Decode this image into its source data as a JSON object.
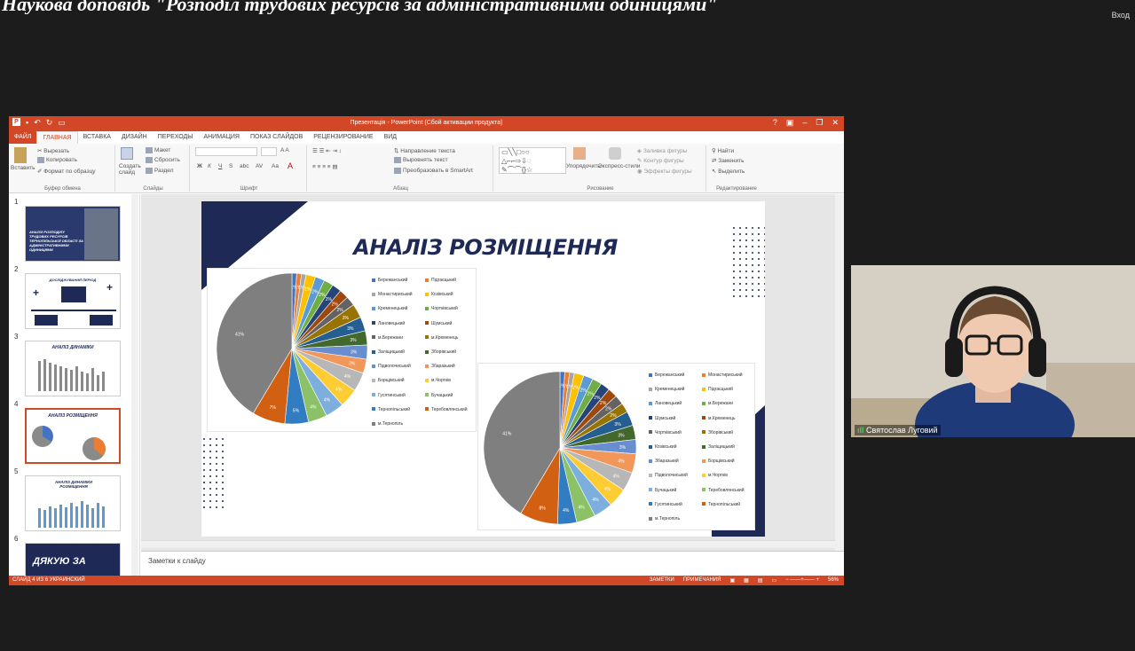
{
  "meeting": {
    "title": "Наукова доповідь \"Розподіл трудових ресурсів за адміністративними одиницями\"",
    "exit_label": "Вход"
  },
  "ppt": {
    "window_title": "Презентація - PowerPoint (Сбой активации продукта)",
    "tabs": [
      "ФАЙЛ",
      "ГЛАВНАЯ",
      "ВСТАВКА",
      "ДИЗАЙН",
      "ПЕРЕХОДЫ",
      "АНИМАЦИЯ",
      "ПОКАЗ СЛАЙДОВ",
      "РЕЦЕНЗИРОВАНИЕ",
      "ВИД"
    ],
    "ribbon": {
      "paste": "Вставить",
      "cut": "Вырезать",
      "copy": "Копировать",
      "format_painter": "Формат по образцу",
      "clipboard_group": "Буфер обмена",
      "create_slide": "Создать слайд",
      "layout": "Макет",
      "reset": "Сбросить",
      "section": "Раздел",
      "slides_group": "Слайды",
      "font_group": "Шрифт",
      "text_direction": "Направление текста",
      "align_text": "Выровнять текст",
      "smartart": "Преобразовать в SmartArt",
      "paragraph_group": "Абзац",
      "arrange": "Упорядочить",
      "quick_styles": "Экспресс-стили",
      "shape_fill": "Заливка фигуры",
      "shape_outline": "Контур фигуры",
      "shape_effects": "Эффекты фигуры",
      "drawing_group": "Рисование",
      "find": "Найти",
      "replace": "Заменить",
      "select": "Выделить",
      "editing_group": "Редактирование"
    },
    "thumbnails": [
      {
        "num": "1",
        "title": "АНАЛІЗ РОЗПОДІЛУ ТРУДОВИХ РЕСУРСІВ ТЕРНОПІЛЬСЬКОЇ ОБЛАСТІ ЗА АДМІНІСТРАТИВНИМИ ОДИНИЦЯМИ"
      },
      {
        "num": "2",
        "title": "ДОСЛІДЖУВАНИЙ ПЕРІОД"
      },
      {
        "num": "3",
        "title": "АНАЛІЗ ДИНАМІКИ"
      },
      {
        "num": "4",
        "title": "АНАЛІЗ РОЗМІЩЕННЯ"
      },
      {
        "num": "5",
        "title": "АНАЛІЗ ДИНАМІКИ РОЗМІЩЕННЯ"
      },
      {
        "num": "6",
        "title": "ДЯКУЮ ЗА"
      }
    ],
    "slide_title": "АНАЛІЗ РОЗМІЩЕННЯ",
    "notes_placeholder": "Заметки к слайду",
    "status_left": "СЛАЙД 4 ИЗ 6    УКРАИНСКИЙ",
    "status_notes": "ЗАМЕТКИ",
    "status_comments": "ПРИМЕЧАНИЯ",
    "zoom": "56%"
  },
  "chart_data": [
    {
      "type": "pie",
      "legend_columns": 2,
      "categories": [
        "Бережанський",
        "Підгаєцький",
        "Монастириський",
        "Козівський",
        "Кременецький",
        "Чортківський",
        "Лановецький",
        "Шумський",
        "м.Бережани",
        "м.Кременець",
        "Заліщицький",
        "Зборівський",
        "Підволочиський",
        "Збаразький",
        "Борщівський",
        "м.Чортків",
        "Гусятинський",
        "Бучацький",
        "Тернопільський",
        "Теребовлянський",
        "м.Тернопіль"
      ],
      "values": [
        1,
        1,
        1,
        2,
        2,
        2,
        2,
        2,
        2,
        3,
        3,
        3,
        3,
        3,
        4,
        4,
        4,
        4,
        5,
        7,
        41
      ],
      "colors": [
        "#4472c4",
        "#ed7d31",
        "#a5a5a5",
        "#ffc000",
        "#5b9bd5",
        "#70ad47",
        "#264478",
        "#9e480e",
        "#636363",
        "#997300",
        "#255e91",
        "#43682b",
        "#698ed0",
        "#f1975a",
        "#b7b7b7",
        "#ffcd33",
        "#7cafdd",
        "#8cc168",
        "#327dc2",
        "#d26012",
        "#7f7f7f"
      ],
      "data_labels": [
        "1%",
        "1%",
        "1%",
        "2%",
        "2%",
        "2%",
        "2%",
        "2%",
        "2%",
        "3%",
        "3%",
        "3%",
        "3%",
        "3%",
        "4%",
        "4%",
        "4%",
        "4%",
        "5%",
        "7%",
        "41%"
      ]
    },
    {
      "type": "pie",
      "legend_columns": 2,
      "categories": [
        "Бережанський",
        "Монастириський",
        "Кременецький",
        "Підгаєцький",
        "Лановецький",
        "м.Бережани",
        "Шумський",
        "м.Кременець",
        "Чортківський",
        "Зборівський",
        "Козівський",
        "Заліщицький",
        "Збаразький",
        "Борщівський",
        "Підволочиський",
        "м.Чортків",
        "Бучацький",
        "Теребовлянський",
        "Гусятинський",
        "Тернопільський",
        "м.Тернопіль"
      ],
      "values": [
        1,
        1,
        1,
        2,
        2,
        2,
        2,
        2,
        2,
        2,
        3,
        3,
        3,
        4,
        4,
        4,
        4,
        4,
        4,
        8,
        41
      ],
      "colors": [
        "#4472c4",
        "#ed7d31",
        "#a5a5a5",
        "#ffc000",
        "#5b9bd5",
        "#70ad47",
        "#264478",
        "#9e480e",
        "#636363",
        "#997300",
        "#255e91",
        "#43682b",
        "#698ed0",
        "#f1975a",
        "#b7b7b7",
        "#ffcd33",
        "#7cafdd",
        "#8cc168",
        "#327dc2",
        "#d26012",
        "#7f7f7f"
      ],
      "data_labels": [
        "1%",
        "1%",
        "1%",
        "2%",
        "2%",
        "2%",
        "2%",
        "2%",
        "2%",
        "2%",
        "3%",
        "3%",
        "3%",
        "4%",
        "4%",
        "4%",
        "4%",
        "4%",
        "4%",
        "8%",
        "41%"
      ]
    }
  ],
  "webcam": {
    "name": "Святослав Луговий"
  }
}
